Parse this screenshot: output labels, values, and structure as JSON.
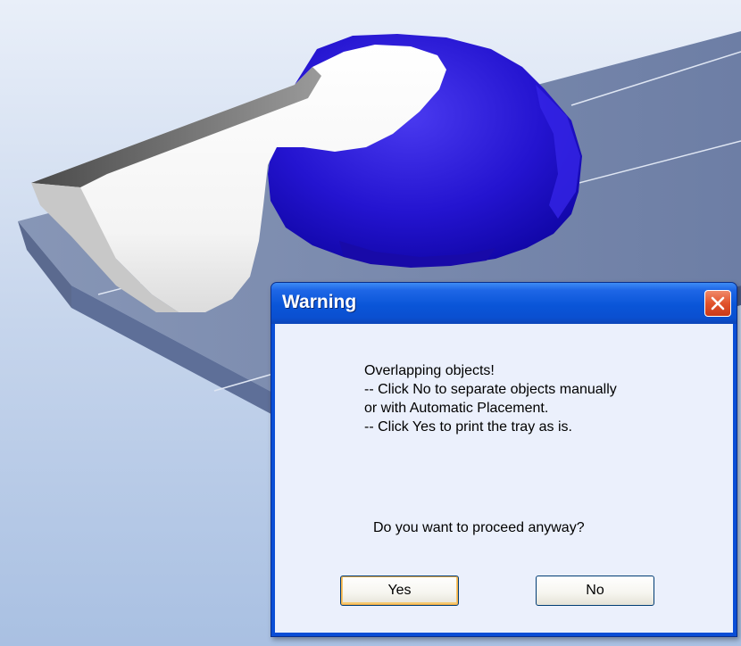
{
  "viewport": {
    "content": "3d-scene"
  },
  "dialog": {
    "title": "Warning",
    "message_lines": [
      "Overlapping objects!",
      "-- Click No to separate objects manually",
      "or with Automatic Placement.",
      "-- Click Yes to print the tray as is."
    ],
    "prompt": "Do you want to proceed anyway?",
    "buttons": {
      "yes": "Yes",
      "no": "No"
    },
    "close_icon": "close-icon"
  },
  "colors": {
    "titlebar": "#0a55d8",
    "dialog_body": "#ebf0fc",
    "close_button": "#e2532c",
    "tray": "#7f8fb2",
    "blue_object": "#2a1ad0",
    "background": "#b8cce8"
  }
}
